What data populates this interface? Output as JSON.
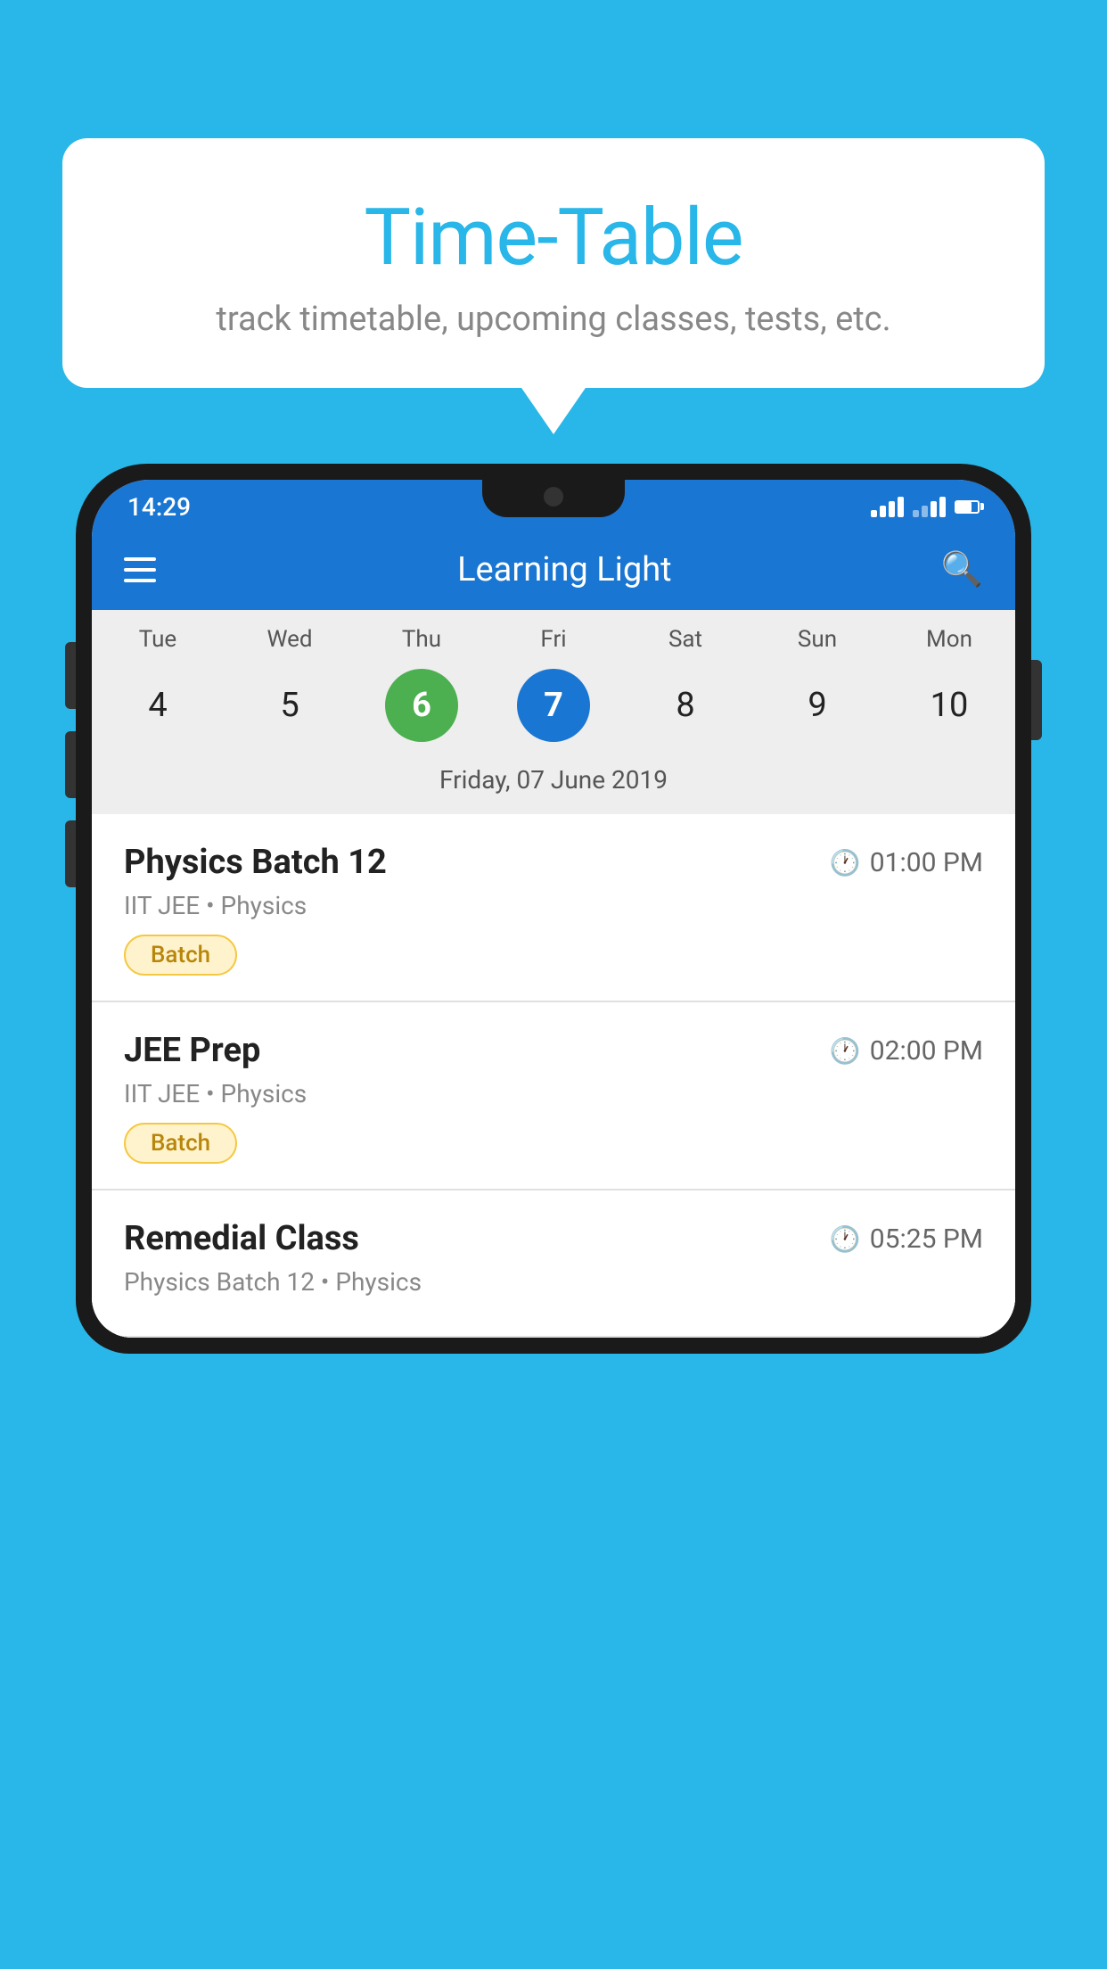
{
  "background_color": "#29b6e8",
  "speech_bubble": {
    "title": "Time-Table",
    "subtitle": "track timetable, upcoming classes, tests, etc."
  },
  "status_bar": {
    "time": "14:29"
  },
  "app_bar": {
    "title": "Learning Light"
  },
  "calendar": {
    "days": [
      "Tue",
      "Wed",
      "Thu",
      "Fri",
      "Sat",
      "Sun",
      "Mon"
    ],
    "dates": [
      "4",
      "5",
      "6",
      "7",
      "8",
      "9",
      "10"
    ],
    "today_index": 2,
    "selected_index": 3,
    "selected_label": "Friday, 07 June 2019"
  },
  "schedule": [
    {
      "title": "Physics Batch 12",
      "time": "01:00 PM",
      "subtitle": "IIT JEE • Physics",
      "tag": "Batch"
    },
    {
      "title": "JEE Prep",
      "time": "02:00 PM",
      "subtitle": "IIT JEE • Physics",
      "tag": "Batch"
    },
    {
      "title": "Remedial Class",
      "time": "05:25 PM",
      "subtitle": "Physics Batch 12 • Physics",
      "tag": ""
    }
  ]
}
